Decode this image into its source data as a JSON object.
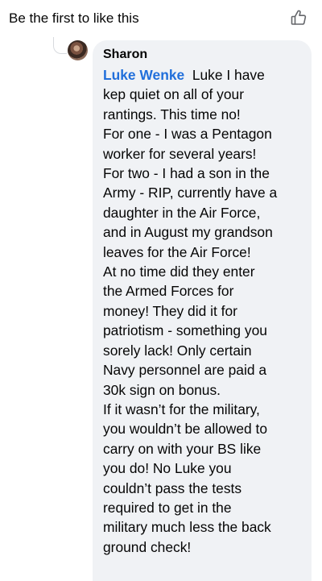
{
  "header": {
    "title": "Be the first to like this"
  },
  "comment": {
    "author": "Sharon",
    "mention": "Luke Wenke",
    "first_line_rest": "  Luke I have",
    "lines": [
      "kep quiet on all of your",
      "rantings.  This time no!",
      "For one - I was a Pentagon",
      "worker for several years!",
      "For two - I had a son in the",
      "Army - RIP, currently have a",
      "daughter in the Air Force,",
      "and in August my grandson",
      "leaves for the Air Force!",
      "At no time did they enter",
      "the Armed Forces for",
      "money!  They did it for",
      "patriotism - something you",
      "sorely lack!  Only certain",
      "Navy personnel are paid a",
      "30k sign on bonus.",
      "If it wasn’t for the military,",
      "you wouldn’t be allowed to",
      "carry on with your BS like",
      "you do!  No Luke you",
      "couldn’t pass the tests",
      "required to get in the",
      "military much less the back",
      "ground check!"
    ]
  },
  "icons": {
    "like": "thumbs-up-icon",
    "avatar": "profile-avatar"
  },
  "colors": {
    "mention": "#216fdb",
    "bubble": "#f0f2f5",
    "text": "#050505"
  }
}
